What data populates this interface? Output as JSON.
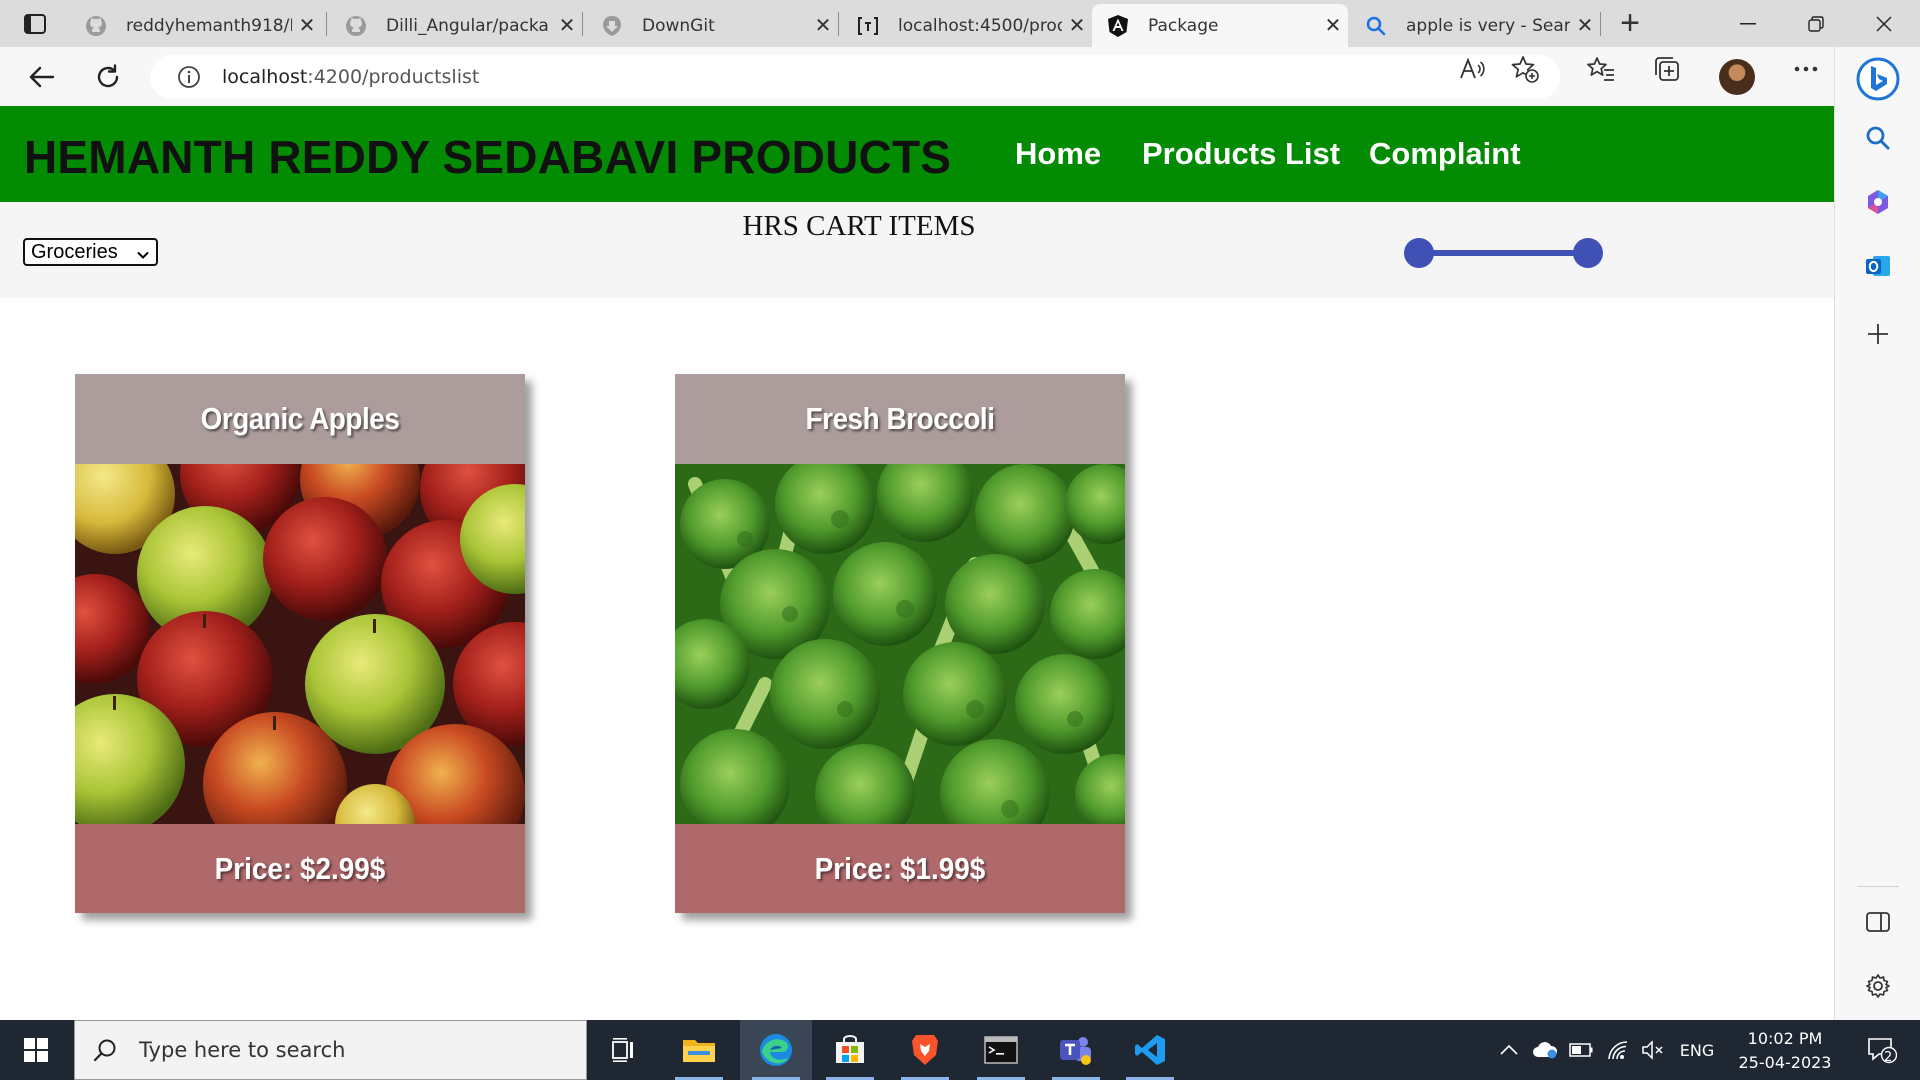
{
  "browser": {
    "tabs": [
      {
        "title": "reddyhemanth918/I",
        "icon": "github-icon"
      },
      {
        "title": "Dilli_Angular/packa",
        "icon": "github-icon"
      },
      {
        "title": "DownGit",
        "icon": "downgit-icon"
      },
      {
        "title": "localhost:4500/prod",
        "icon": "page-icon"
      },
      {
        "title": "Package",
        "icon": "angular-icon"
      },
      {
        "title": "apple is very - Searc",
        "icon": "search-icon"
      }
    ],
    "active_tab_index": 4,
    "address": {
      "host": "localhost",
      "path": ":4200/productslist"
    }
  },
  "site": {
    "brand": "HEMANTH REDDY SEDABAVI PRODUCTS",
    "nav": {
      "home": "Home",
      "products": "Products List",
      "complaint": "Complaint"
    }
  },
  "filter": {
    "category": "Groceries",
    "title": "HRS CART ITEMS",
    "accent_color": "#3f51b5"
  },
  "products": [
    {
      "name": "Organic Apples",
      "price": "Price: $2.99$",
      "image": "apples-photo"
    },
    {
      "name": "Fresh Broccoli",
      "price": "Price: $1.99$",
      "image": "broccoli-photo"
    }
  ],
  "colors": {
    "header_bg": "#038c03",
    "card_name_bg": "#ad9c9c",
    "card_price_bg": "#b0696b",
    "taskbar_bg": "#1f2733"
  },
  "taskbar": {
    "search_placeholder": "Type here to search",
    "language": "ENG",
    "time": "10:02 PM",
    "date": "25-04-2023",
    "notification_count": "2"
  }
}
